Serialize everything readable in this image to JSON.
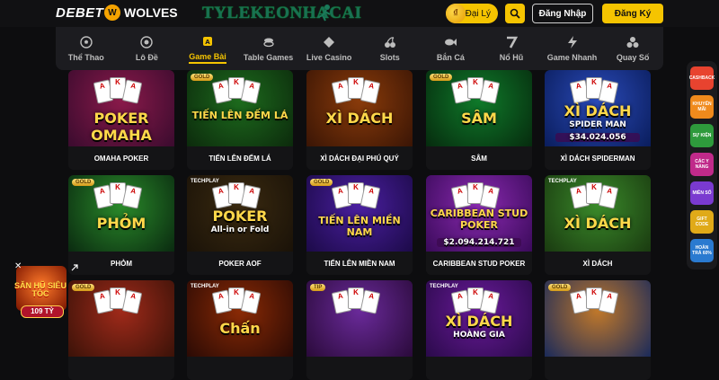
{
  "header": {
    "logo_text": "DEBET",
    "partner": "WOLVES",
    "watermark": "TYLEKEONHACAI",
    "agent_label": "Đại Lý",
    "login_label": "Đăng Nhập",
    "register_label": "Đăng Ký"
  },
  "nav": [
    {
      "label": "Thể Thao",
      "icon": "soccer-ball-icon"
    },
    {
      "label": "Lô Đề",
      "icon": "lottery-icon"
    },
    {
      "label": "Game Bài",
      "icon": "cards-icon",
      "active": true
    },
    {
      "label": "Table Games",
      "icon": "chips-icon"
    },
    {
      "label": "Live Casino",
      "icon": "diamond-icon"
    },
    {
      "label": "Slots",
      "icon": "cherry-icon"
    },
    {
      "label": "Bắn Cá",
      "icon": "fish-icon"
    },
    {
      "label": "Nổ Hũ",
      "icon": "seven-icon"
    },
    {
      "label": "Game Nhanh",
      "icon": "lightning-icon"
    },
    {
      "label": "Quay Số",
      "icon": "balls-icon"
    }
  ],
  "games": [
    {
      "label": "OMAHA POKER",
      "art": "POKER OMAHA",
      "badge": "",
      "bg": [
        "#3a0b2e",
        "#8a1a4a"
      ]
    },
    {
      "label": "TIẾN LÊN ĐẾM LÁ",
      "art": "TIẾN LÊN ĐẾM LÁ",
      "badge": "GOLD",
      "bg": [
        "#0c2a0c",
        "#1d6b1d"
      ]
    },
    {
      "label": "XÌ DÁCH ĐẠI PHÚ QUÝ",
      "art": "XÌ DÁCH",
      "badge": "",
      "bg": [
        "#3a1505",
        "#8a3b0a"
      ]
    },
    {
      "label": "SÂM",
      "art": "SÂM",
      "badge": "GOLD",
      "bg": [
        "#062b0e",
        "#0f7a2a"
      ]
    },
    {
      "label": "XÌ DÁCH SPIDERMAN",
      "art": "XÌ DÁCH",
      "art2": "SPIDER MAN",
      "amount": "$34.024.056",
      "badge": "",
      "bg": [
        "#0a1d5c",
        "#2a4ab8"
      ]
    },
    {
      "label": "PHỎM",
      "art": "PHỎM",
      "badge": "GOLD",
      "bg": [
        "#0a2a10",
        "#2a8a2a"
      ]
    },
    {
      "label": "POKER AOF",
      "art": "POKER",
      "art2": "All-in or Fold",
      "badge": "TECHPLAY",
      "bg": [
        "#1a1208",
        "#3a2a10"
      ]
    },
    {
      "label": "TIẾN LÊN MIỀN NAM",
      "art": "TIẾN LÊN MIỀN NAM",
      "badge": "GOLD",
      "bg": [
        "#1c0a48",
        "#4a1fa0"
      ]
    },
    {
      "label": "CARIBBEAN STUD POKER",
      "art": "CARIBBEAN STUD POKER",
      "amount": "$2.094.214.721",
      "badge": "",
      "bg": [
        "#3a0a5a",
        "#8a2ab0"
      ]
    },
    {
      "label": "XÌ DÁCH",
      "art": "XÌ DÁCH",
      "badge": "TECHPLAY",
      "bg": [
        "#1a3a10",
        "#3a8a2a"
      ]
    },
    {
      "label": "",
      "art": "",
      "badge": "GOLD",
      "bg": [
        "#3a1208",
        "#a02a1a"
      ]
    },
    {
      "label": "",
      "art": "Chấn",
      "badge": "TECHPLAY",
      "bg": [
        "#2a0a05",
        "#8a2a05"
      ]
    },
    {
      "label": "",
      "art": "",
      "badge": "TIP",
      "bg": [
        "#2a0a3a",
        "#6a2a9a"
      ]
    },
    {
      "label": "",
      "art": "XÌ DÁCH",
      "art2": "HOÀNG GIA",
      "badge": "TECHPLAY",
      "bg": [
        "#2a0a4a",
        "#6a1a9a"
      ]
    },
    {
      "label": "",
      "art": "",
      "badge": "GOLD",
      "bg": [
        "#1a2a5a",
        "#c0782a"
      ]
    }
  ],
  "rail": [
    {
      "label": "CASHBACK",
      "color": "#e8432f"
    },
    {
      "label": "KHUYẾN MÃI",
      "color": "#f08a1c"
    },
    {
      "label": "SỰ KIỆN",
      "color": "#2e9a3c"
    },
    {
      "label": "CÁC Y NÀNG",
      "color": "#c02a8a"
    },
    {
      "label": "MIỀN SỐ",
      "color": "#7a3ad0"
    },
    {
      "label": "GIFT CODE",
      "color": "#e0aa18"
    },
    {
      "label": "HOÀN TRẢ 60%",
      "color": "#2a7ad0"
    }
  ],
  "float_promo": {
    "title": "SĂN HŨ SIÊU TỐC",
    "amount": "109 TỶ"
  }
}
